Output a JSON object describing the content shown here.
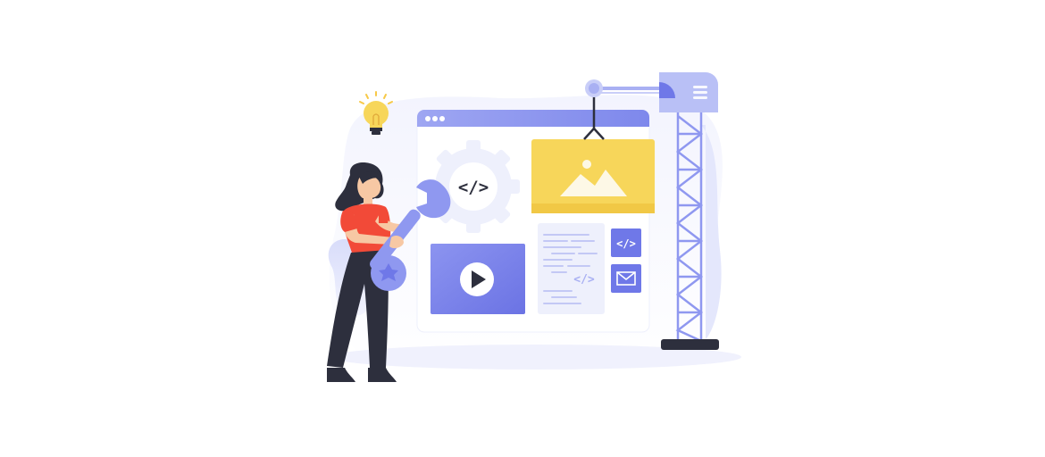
{
  "illustration": {
    "gear_code": "</>",
    "side_code_tile": "</>",
    "doc_code": "</>",
    "icons": [
      "lightbulb-icon",
      "gear-icon",
      "wrench-icon",
      "image-icon",
      "play-icon",
      "code-icon",
      "mail-icon",
      "crane-icon",
      "person-figure"
    ]
  },
  "colors": {
    "primary": "#6F78E8",
    "light_primary": "#A9B0F3",
    "pale": "#EEF0FC",
    "yellow": "#F7D65A",
    "red_shirt": "#F24A38",
    "dark": "#2D2F3D",
    "skin": "#F7C8A4"
  }
}
